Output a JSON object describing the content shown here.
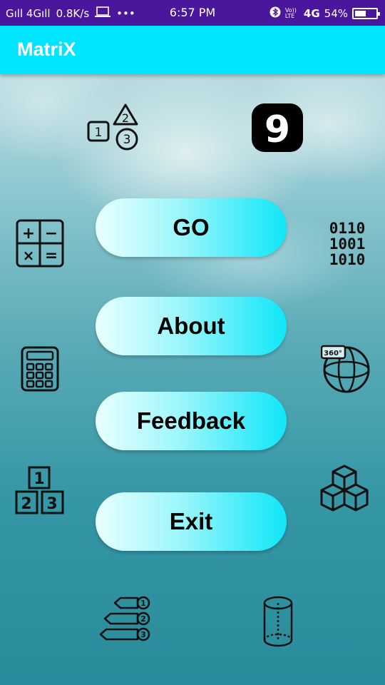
{
  "status_bar": {
    "signal_left": "Gıll 4Gıll",
    "speed": "0.8K/s",
    "dots": "•••",
    "time": "6:57 PM",
    "volte": "Vo)) LTE",
    "network": "4G",
    "battery_percent": "54%",
    "battery_level": 0.54
  },
  "app_bar": {
    "title": "MatriX"
  },
  "menu": {
    "go_label": "GO",
    "about_label": "About",
    "feedback_label": "Feedback",
    "exit_label": "Exit"
  },
  "icons": {
    "numbers_shapes": {
      "digits": [
        "1",
        "2",
        "3"
      ]
    },
    "nine": {
      "digit": "9"
    },
    "calc_ops": {
      "symbols": [
        "+",
        "−",
        "×",
        "="
      ]
    },
    "binary": {
      "rows": [
        "0110",
        "1001",
        "1010"
      ]
    },
    "stack": {
      "digits": [
        "1",
        "2",
        "3"
      ]
    },
    "arrows": {
      "digits": [
        "1",
        "2",
        "3"
      ]
    },
    "sphere": {
      "label": "360°"
    }
  },
  "colors": {
    "status_bar": "#4a169c",
    "app_bar": "#00e5ff",
    "button_start": "#e9ffff",
    "button_end": "#10e6f8"
  }
}
